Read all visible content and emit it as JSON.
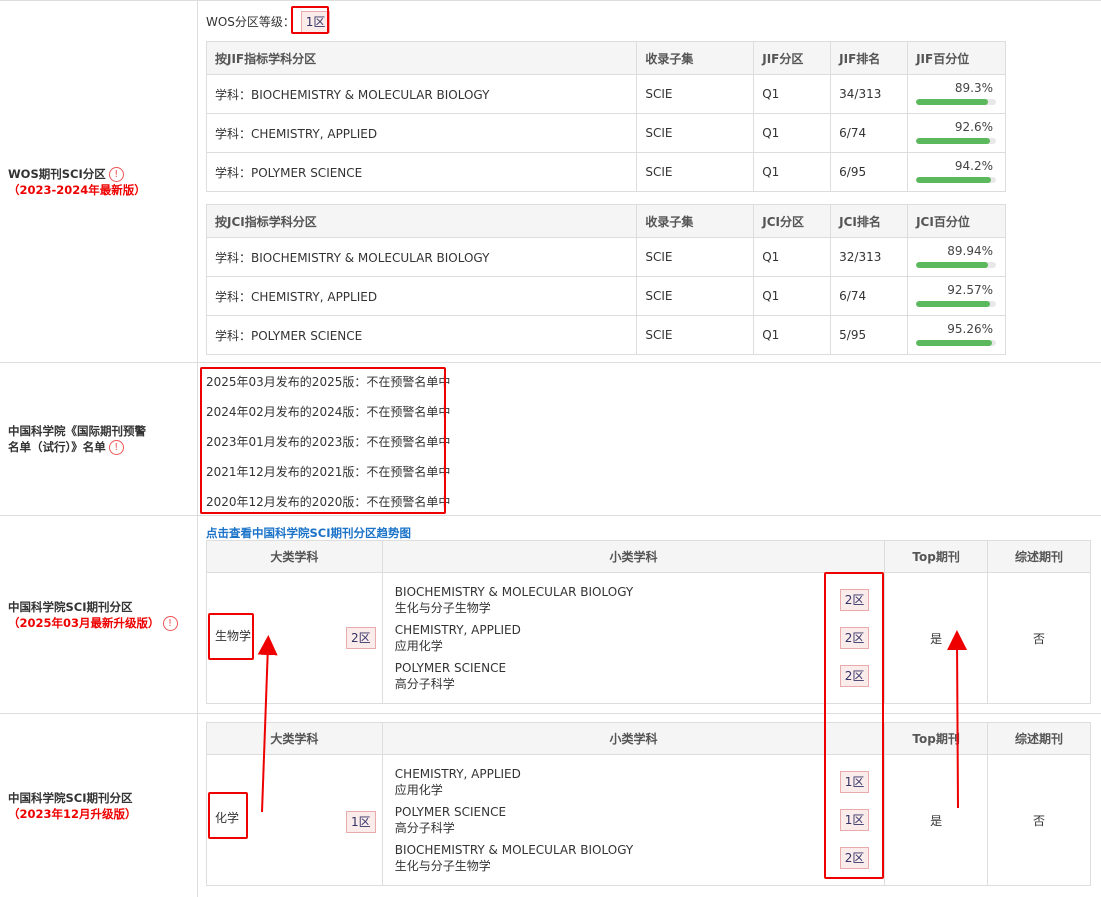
{
  "wos": {
    "label_line1": "WOS期刊SCI分区",
    "label_line2": "（2023-2024年最新版）",
    "level_label": "WOS分区等级：",
    "level_value": "1区",
    "jif_table": {
      "headers": [
        "按JIF指标学科分区",
        "收录子集",
        "JIF分区",
        "JIF排名",
        "JIF百分位"
      ],
      "rows": [
        {
          "subject": "学科：BIOCHEMISTRY & MOLECULAR BIOLOGY",
          "set": "SCIE",
          "quartile": "Q1",
          "rank": "34/313",
          "pct": "89.3%",
          "pct_value": 89.3
        },
        {
          "subject": "学科：CHEMISTRY, APPLIED",
          "set": "SCIE",
          "quartile": "Q1",
          "rank": "6/74",
          "pct": "92.6%",
          "pct_value": 92.6
        },
        {
          "subject": "学科：POLYMER SCIENCE",
          "set": "SCIE",
          "quartile": "Q1",
          "rank": "6/95",
          "pct": "94.2%",
          "pct_value": 94.2
        }
      ]
    },
    "jci_table": {
      "headers": [
        "按JCI指标学科分区",
        "收录子集",
        "JCI分区",
        "JCI排名",
        "JCI百分位"
      ],
      "rows": [
        {
          "subject": "学科：BIOCHEMISTRY & MOLECULAR BIOLOGY",
          "set": "SCIE",
          "quartile": "Q1",
          "rank": "32/313",
          "pct": "89.94%",
          "pct_value": 89.94
        },
        {
          "subject": "学科：CHEMISTRY, APPLIED",
          "set": "SCIE",
          "quartile": "Q1",
          "rank": "6/74",
          "pct": "92.57%",
          "pct_value": 92.57
        },
        {
          "subject": "学科：POLYMER SCIENCE",
          "set": "SCIE",
          "quartile": "Q1",
          "rank": "5/95",
          "pct": "95.26%",
          "pct_value": 95.26
        }
      ]
    }
  },
  "warning": {
    "label_line1": "中国科学院《国际期刊预警",
    "label_line2": "名单（试行）》名单",
    "items": [
      "2025年03月发布的2025版：不在预警名单中",
      "2024年02月发布的2024版：不在预警名单中",
      "2023年01月发布的2023版：不在预警名单中",
      "2021年12月发布的2021版：不在预警名单中",
      "2020年12月发布的2020版：不在预警名单中"
    ]
  },
  "cas2025": {
    "label_line1": "中国科学院SCI期刊分区",
    "label_line2": "（2025年03月最新升级版）",
    "trend_link": "点击查看中国科学院SCI期刊分区趋势图",
    "headers": [
      "大类学科",
      "小类学科",
      "Top期刊",
      "综述期刊"
    ],
    "major": "生物学",
    "major_zone": "2区",
    "minors": [
      {
        "en": "BIOCHEMISTRY & MOLECULAR BIOLOGY",
        "cn": "生化与分子生物学",
        "zone": "2区"
      },
      {
        "en": "CHEMISTRY, APPLIED",
        "cn": "应用化学",
        "zone": "2区"
      },
      {
        "en": "POLYMER SCIENCE",
        "cn": "高分子科学",
        "zone": "2区"
      }
    ],
    "top": "是",
    "review": "否"
  },
  "cas2023": {
    "label_line1": "中国科学院SCI期刊分区",
    "label_line2": "（2023年12月升级版）",
    "headers": [
      "大类学科",
      "小类学科",
      "Top期刊",
      "综述期刊"
    ],
    "major": "化学",
    "major_zone": "1区",
    "minors": [
      {
        "en": "CHEMISTRY, APPLIED",
        "cn": "应用化学",
        "zone": "1区"
      },
      {
        "en": "POLYMER SCIENCE",
        "cn": "高分子科学",
        "zone": "1区"
      },
      {
        "en": "BIOCHEMISTRY & MOLECULAR BIOLOGY",
        "cn": "生化与分子生物学",
        "zone": "2区"
      }
    ],
    "top": "是",
    "review": "否"
  },
  "colors": {
    "highlight": "#e00000",
    "bar": "#5cb85c",
    "link": "#1a73c8"
  }
}
